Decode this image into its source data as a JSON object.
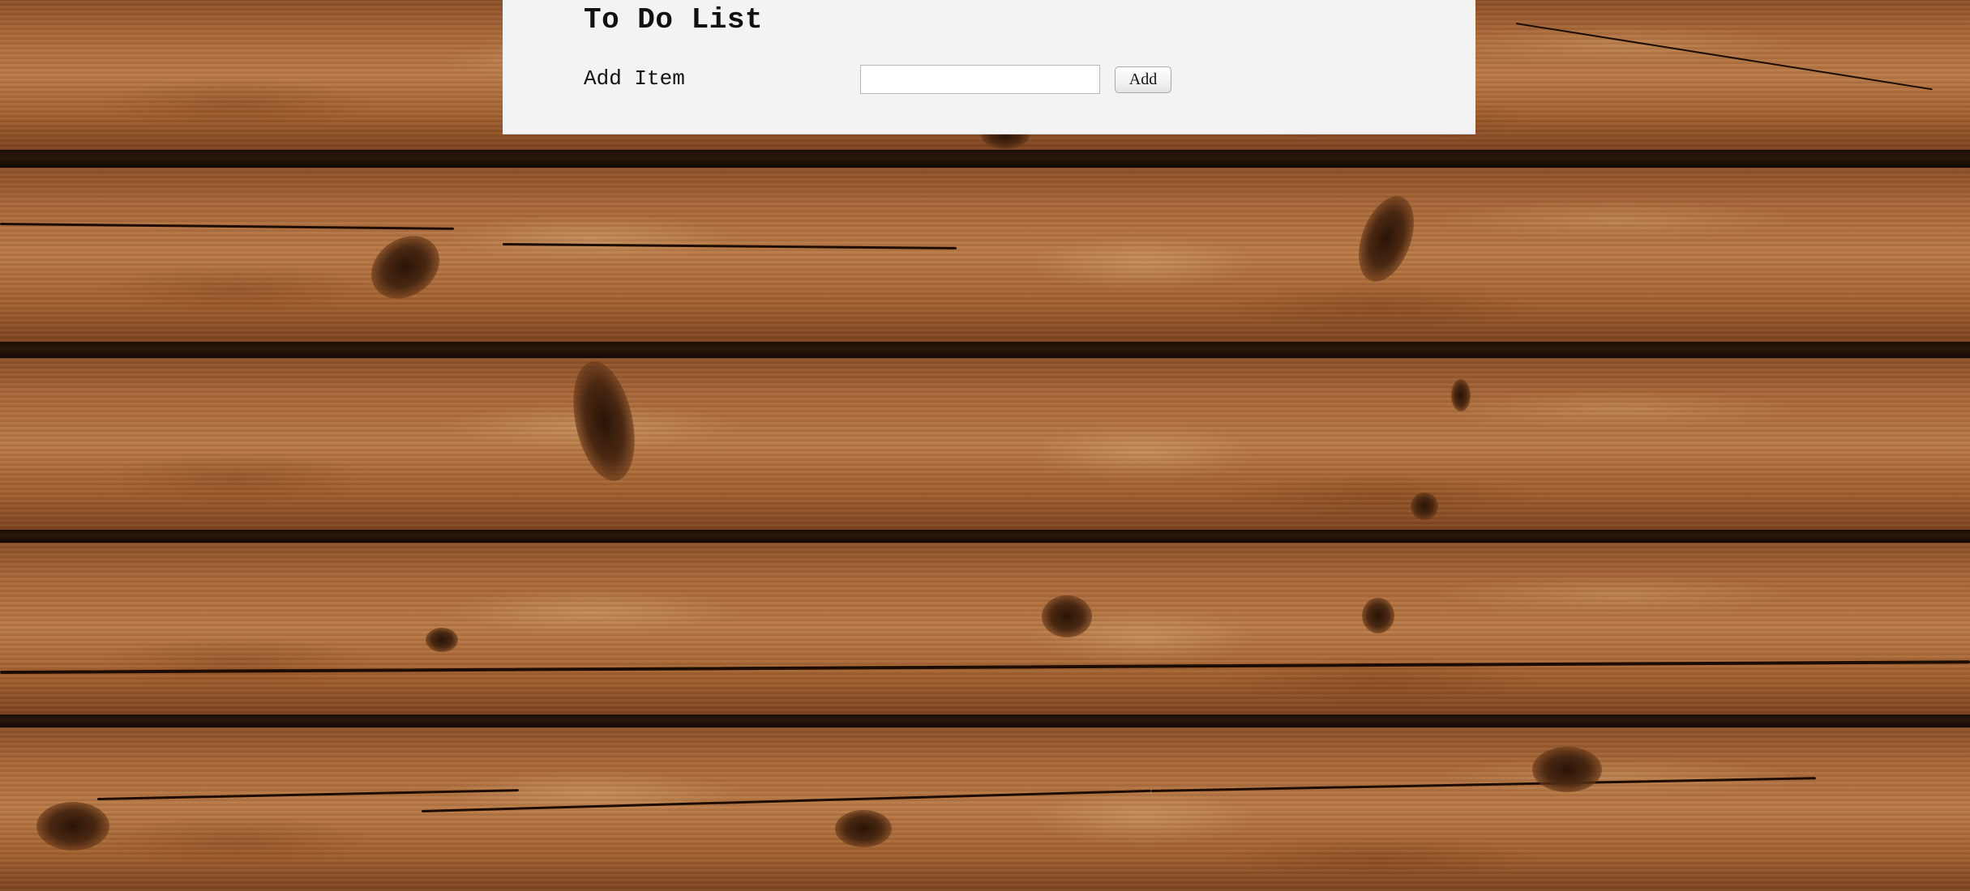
{
  "app": {
    "title": "To Do List"
  },
  "add_item": {
    "label": "Add Item",
    "input_value": "",
    "input_placeholder": "",
    "button_label": "Add"
  },
  "background": {
    "texture": "wooden-planks",
    "colors": {
      "wood_light": "#b87a48",
      "wood_dark": "#7a4220",
      "gap": "#1a0d05"
    }
  },
  "colors": {
    "panel_background": "#f3f3f3",
    "text": "#111111"
  }
}
